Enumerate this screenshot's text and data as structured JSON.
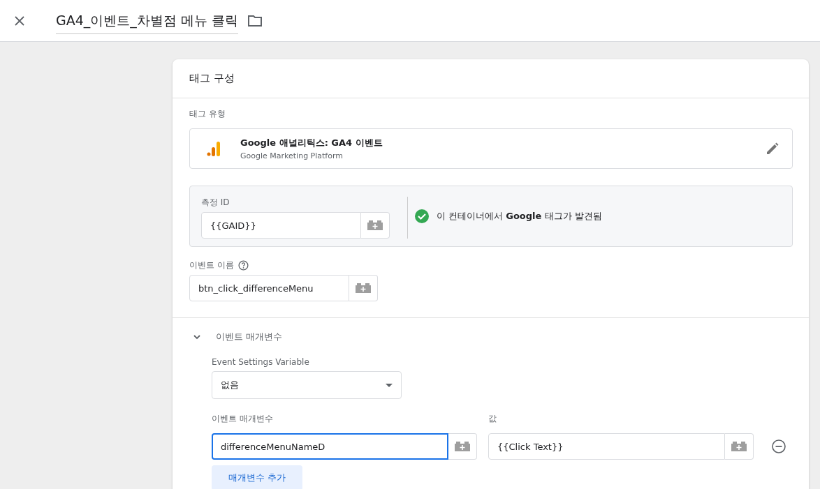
{
  "header": {
    "title": "GA4_이벤트_차별점 메뉴 클릭"
  },
  "card": {
    "title": "태그 구성",
    "tag_type": {
      "label": "태그 유형",
      "name": "Google 애널리틱스: GA4 이벤트",
      "vendor": "Google Marketing Platform"
    },
    "measurement": {
      "label": "측정 ID",
      "value": "{{GAID}}",
      "status": "이 컨테이너에서 **Google** 태그가 발견됨"
    },
    "event_name": {
      "label": "이벤트 이름",
      "value": "btn_click_differenceMenu"
    },
    "parameters": {
      "title": "이벤트 매개변수",
      "expanded": true,
      "settings_variable": {
        "label": "Event Settings Variable",
        "value": "없음"
      },
      "name_label": "이벤트 매개변수",
      "value_label": "값",
      "rows": [
        {
          "name": "differenceMenuNameD",
          "value": "{{Click Text}}",
          "focused": true
        }
      ],
      "add_button": "매개변수 추가"
    }
  }
}
